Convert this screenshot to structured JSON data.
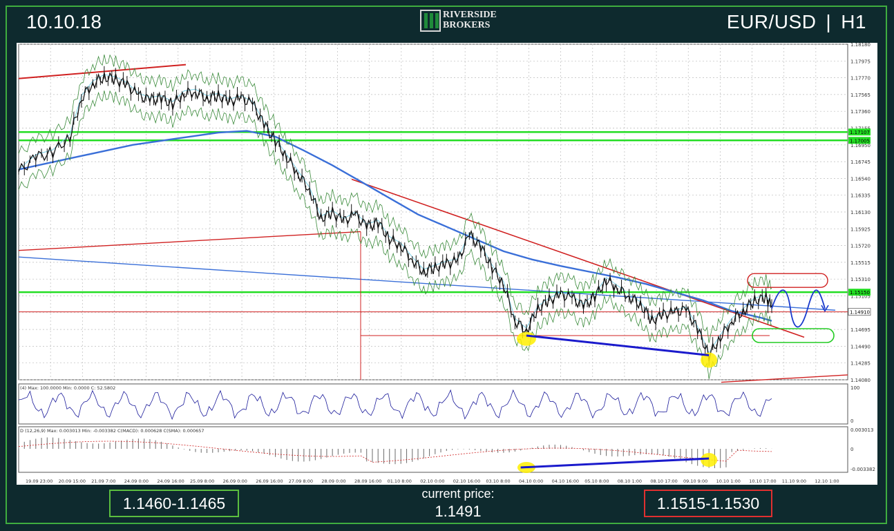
{
  "header": {
    "date": "10.10.18",
    "pair": "EUR/USD",
    "separator": "|",
    "timeframe": "H1"
  },
  "logo": {
    "line1": "RIVERSIDE",
    "line2": "BROKERS"
  },
  "footer": {
    "support_range": "1.1460-1.1465",
    "current_price_label": "current price:",
    "current_price": "1.1491",
    "resistance_range": "1.1515-1.1530"
  },
  "colors": {
    "support": "#5bbf3f",
    "resistance": "#e03030",
    "ma": "#3a6fd8",
    "trend": "#d02020",
    "level": "#22dd22"
  },
  "chart_data": {
    "type": "line",
    "instrument": "EUR/USD",
    "timeframe": "H1",
    "y_ticks": [
      "1.18180",
      "1.17975",
      "1.17770",
      "1.17565",
      "1.17360",
      "1.17155",
      "1.16950",
      "1.16745",
      "1.16540",
      "1.16335",
      "1.16130",
      "1.15925",
      "1.15720",
      "1.15515",
      "1.15310",
      "1.15105",
      "1.14900",
      "1.14695",
      "1.14490",
      "1.14285",
      "1.14080"
    ],
    "price_tags": [
      "1.17107",
      "1.17005",
      "1.15150",
      "1.14910"
    ],
    "x_ticks": [
      "19.09 23:00",
      "20.09 15:00",
      "21.09 7:00",
      "24.09 0:00",
      "24.09 16:00",
      "25.09 8:00",
      "26.09 0:00",
      "26.09 16:00",
      "27.09 8:00",
      "28.09 0:00",
      "28.09 16:00",
      "01.10 8:00",
      "02.10 0:00",
      "02.10 16:00",
      "03.10 8:00",
      "04.10 0:00",
      "04.10 16:00",
      "05.10 8:00",
      "08.10 1:00",
      "08.10 17:00",
      "09.10 9:00",
      "10.10 1:00",
      "10.10 17:00",
      "11.10 9:00",
      "12.10 1:00"
    ],
    "ylim": [
      1.1408,
      1.1818
    ],
    "levels": [
      1.17107,
      1.17005,
      1.1515
    ],
    "current_price": 1.1491,
    "price_path": [
      [
        0,
        1.1662
      ],
      [
        3,
        1.168
      ],
      [
        6,
        1.1686
      ],
      [
        9,
        1.1705
      ],
      [
        11,
        1.1752
      ],
      [
        13,
        1.177
      ],
      [
        15,
        1.1778
      ],
      [
        17,
        1.1775
      ],
      [
        19,
        1.1768
      ],
      [
        21,
        1.1755
      ],
      [
        23,
        1.175
      ],
      [
        25,
        1.1752
      ],
      [
        27,
        1.1745
      ],
      [
        29,
        1.1758
      ],
      [
        31,
        1.176
      ],
      [
        33,
        1.1752
      ],
      [
        35,
        1.1755
      ],
      [
        37,
        1.1748
      ],
      [
        39,
        1.1752
      ],
      [
        41,
        1.1745
      ],
      [
        43,
        1.172
      ],
      [
        45,
        1.17
      ],
      [
        47,
        1.168
      ],
      [
        49,
        1.166
      ],
      [
        51,
        1.164
      ],
      [
        53,
        1.1605
      ],
      [
        55,
        1.1612
      ],
      [
        57,
        1.1602
      ],
      [
        59,
        1.161
      ],
      [
        61,
        1.1595
      ],
      [
        63,
        1.16
      ],
      [
        65,
        1.158
      ],
      [
        67,
        1.1572
      ],
      [
        69,
        1.1555
      ],
      [
        71,
        1.154
      ],
      [
        73,
        1.1545
      ],
      [
        75,
        1.155
      ],
      [
        77,
        1.1553
      ],
      [
        79,
        1.1585
      ],
      [
        81,
        1.157
      ],
      [
        83,
        1.1545
      ],
      [
        85,
        1.1525
      ],
      [
        87,
        1.148
      ],
      [
        89,
        1.1468
      ],
      [
        91,
        1.1495
      ],
      [
        93,
        1.1505
      ],
      [
        95,
        1.1512
      ],
      [
        97,
        1.1508
      ],
      [
        99,
        1.1498
      ],
      [
        101,
        1.151
      ],
      [
        103,
        1.153
      ],
      [
        105,
        1.152
      ],
      [
        107,
        1.151
      ],
      [
        109,
        1.15
      ],
      [
        111,
        1.148
      ],
      [
        113,
        1.1488
      ],
      [
        115,
        1.149
      ],
      [
        117,
        1.1494
      ],
      [
        119,
        1.147
      ],
      [
        121,
        1.1438
      ],
      [
        123,
        1.146
      ],
      [
        125,
        1.148
      ],
      [
        127,
        1.1492
      ],
      [
        129,
        1.1505
      ],
      [
        131,
        1.1508
      ],
      [
        132,
        1.1498
      ]
    ],
    "ma_path": [
      [
        0,
        1.1665
      ],
      [
        10,
        1.168
      ],
      [
        20,
        1.1695
      ],
      [
        30,
        1.1705
      ],
      [
        35,
        1.171
      ],
      [
        40,
        1.1712
      ],
      [
        45,
        1.1705
      ],
      [
        50,
        1.1688
      ],
      [
        55,
        1.167
      ],
      [
        60,
        1.165
      ],
      [
        65,
        1.163
      ],
      [
        70,
        1.161
      ],
      [
        75,
        1.1595
      ],
      [
        80,
        1.158
      ],
      [
        85,
        1.1565
      ],
      [
        90,
        1.1555
      ],
      [
        95,
        1.1547
      ],
      [
        100,
        1.154
      ],
      [
        105,
        1.1533
      ],
      [
        110,
        1.1525
      ],
      [
        115,
        1.1515
      ],
      [
        120,
        1.1505
      ],
      [
        125,
        1.1492
      ],
      [
        130,
        1.1484
      ],
      [
        132,
        1.148
      ]
    ],
    "indicators": {
      "oscillator_header": "(4)  Max: 100.0000  Min: 0.0000  C: 52.5802",
      "oscillator_ticks": [
        "100",
        "0"
      ],
      "macd_header": "D (12,26,9)  Max: 0.003013  Min: -0.003382  C(MACD): 0.000628  C(SMA): 0.000657",
      "macd_ticks": [
        "0.003013",
        "0",
        "-0.003382"
      ]
    }
  }
}
